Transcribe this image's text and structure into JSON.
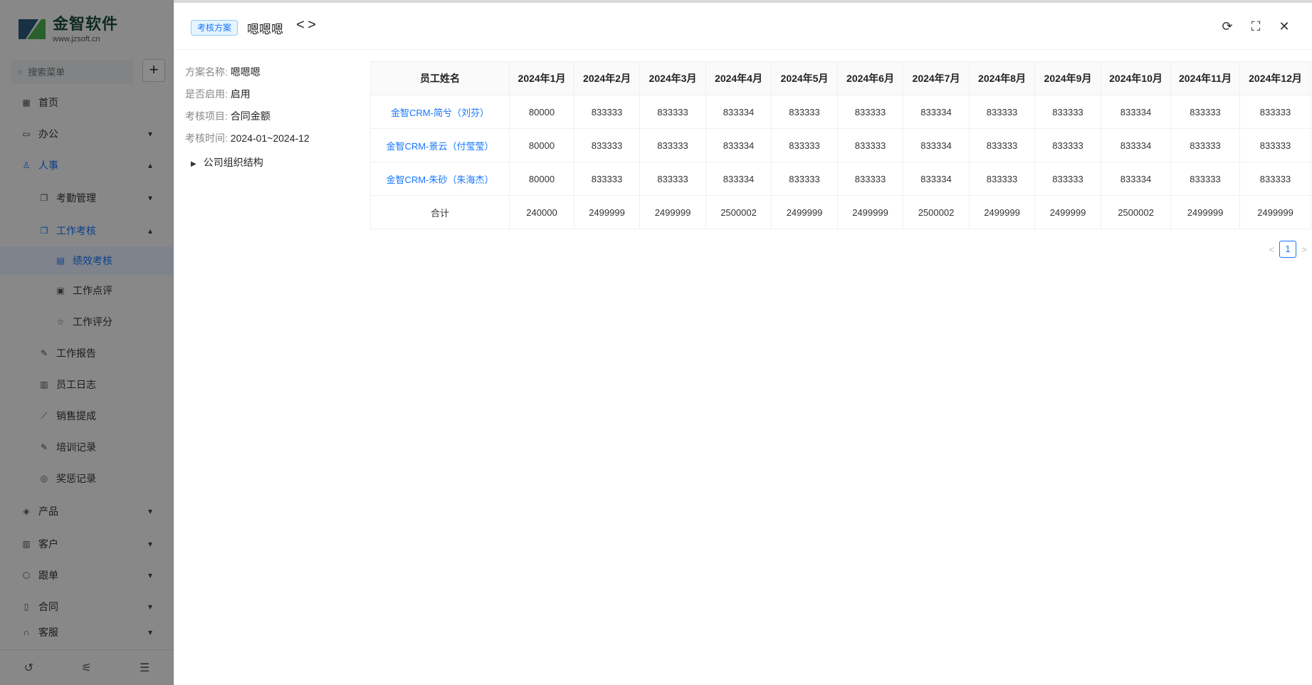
{
  "sidebar": {
    "logo_title": "金智软件",
    "logo_sub": "www.jzsoft.cn",
    "search_placeholder": "搜索菜单",
    "add_label": "+",
    "items": [
      {
        "label": "首页"
      },
      {
        "label": "办公"
      },
      {
        "label": "人事"
      },
      {
        "label": "考勤管理"
      },
      {
        "label": "工作考核"
      },
      {
        "label": "绩效考核"
      },
      {
        "label": "工作点评"
      },
      {
        "label": "工作评分"
      },
      {
        "label": "工作报告"
      },
      {
        "label": "员工日志"
      },
      {
        "label": "销售提成"
      },
      {
        "label": "培训记录"
      },
      {
        "label": "奖惩记录"
      },
      {
        "label": "产品"
      },
      {
        "label": "客户"
      },
      {
        "label": "跟单"
      },
      {
        "label": "合同"
      },
      {
        "label": "客服"
      }
    ]
  },
  "drawer": {
    "tag": "考核方案",
    "title": "嗯嗯嗯",
    "prev": "<",
    "next": ">",
    "refresh": "⟳",
    "fullscreen": "⛶",
    "close": "✕"
  },
  "info": {
    "name_label": "方案名称:",
    "name_value": "嗯嗯嗯",
    "enabled_label": "是否启用:",
    "enabled_value": "启用",
    "item_label": "考核项目:",
    "item_value": "合同金额",
    "time_label": "考核时间:",
    "time_value": "2024-01~2024-12",
    "tree_label": "公司组织结构"
  },
  "table": {
    "headers": [
      "员工姓名",
      "2024年1月",
      "2024年2月",
      "2024年3月",
      "2024年4月",
      "2024年5月",
      "2024年6月",
      "2024年7月",
      "2024年8月",
      "2024年9月",
      "2024年10月",
      "2024年11月",
      "2024年12月"
    ],
    "rows": [
      [
        "金智CRM-简兮（刘芬）",
        "80000",
        "833333",
        "833333",
        "833334",
        "833333",
        "833333",
        "833334",
        "833333",
        "833333",
        "833334",
        "833333",
        "833333"
      ],
      [
        "金智CRM-景云（付莹莹）",
        "80000",
        "833333",
        "833333",
        "833334",
        "833333",
        "833333",
        "833334",
        "833333",
        "833333",
        "833334",
        "833333",
        "833333"
      ],
      [
        "金智CRM-朱砂（朱海杰）",
        "80000",
        "833333",
        "833333",
        "833334",
        "833333",
        "833333",
        "833334",
        "833333",
        "833333",
        "833334",
        "833333",
        "833333"
      ]
    ],
    "total": [
      "合计",
      "240000",
      "2499999",
      "2499999",
      "2500002",
      "2499999",
      "2499999",
      "2500002",
      "2499999",
      "2499999",
      "2500002",
      "2499999",
      "2499999"
    ]
  },
  "pager": {
    "prev": "<",
    "page": "1",
    "next": ">"
  }
}
